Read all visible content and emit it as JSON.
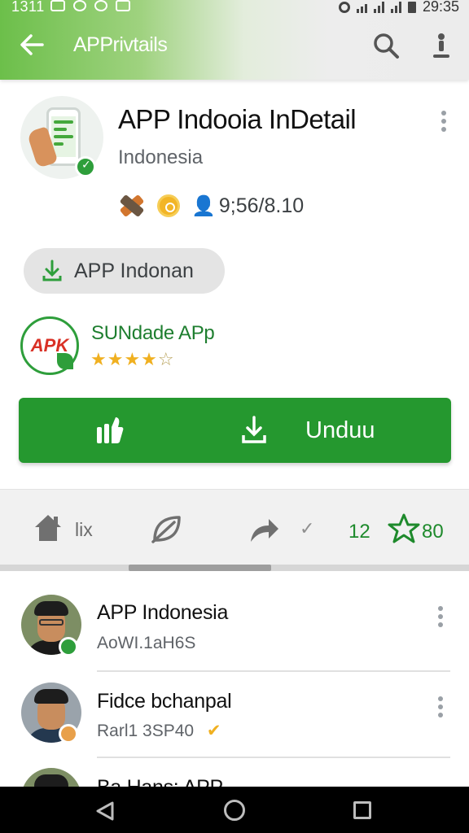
{
  "status_bar": {
    "time_left": "1311",
    "time_right": "29:35"
  },
  "app_bar": {
    "title": "APPrivtails",
    "back_icon": "arrow-left-icon",
    "search_icon": "search-icon",
    "more_icon": "more-vert-icon"
  },
  "header": {
    "app_name": "APP Indooia InDetail",
    "developer": "Indonesia",
    "stat": "9;56/8.10"
  },
  "chip": {
    "label": "APP Indonan",
    "icon": "download-icon"
  },
  "apk": {
    "logo_text": "APK",
    "name": "SUNdade APp",
    "rating_stars": 4,
    "stars_filled": "★★★★",
    "stars_empty": "☆"
  },
  "download": {
    "label": "Unduu",
    "accent": "#25982f"
  },
  "stats": {
    "home_label": "lix",
    "check": "✓",
    "count_left": "12",
    "count_right": "80",
    "brand_color": "#1e8a2c"
  },
  "list": {
    "items": [
      {
        "title": "APP Indonesia",
        "subtitle": "AoWI.1aH6S"
      },
      {
        "title": "Fidce bchanpal",
        "subtitle": "Rarl1 3SP40"
      },
      {
        "title": "Ba Hans: APP",
        "subtitle": ""
      }
    ]
  }
}
